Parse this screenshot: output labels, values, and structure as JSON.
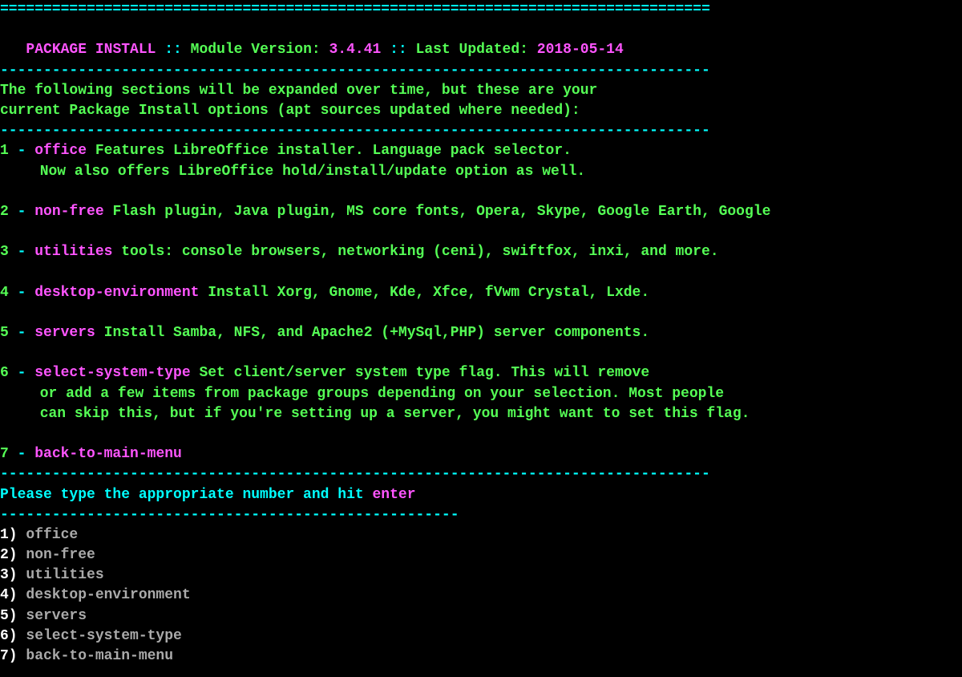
{
  "divider_eq": "==================================================================================",
  "divider_dash": "----------------------------------------------------------------------------------",
  "divider_dash_short": "-----------------------------------------------------",
  "header": {
    "title": "PACKAGE INSTALL",
    "sep": " :: ",
    "mod_label": "Module Version: ",
    "mod_version": "3.4.41",
    "updated_label": "Last Updated: ",
    "updated_value": "2018-05-14"
  },
  "intro": {
    "l1": "The following sections will be expanded over time, but these are your",
    "l2": "current Package Install options (apt sources updated where needed):"
  },
  "opts": [
    {
      "num": "1",
      "dash": " - ",
      "key": "office",
      "desc": " Features LibreOffice installer. Language pack selector.",
      "cont": [
        "Now also offers LibreOffice hold/install/update option as well."
      ]
    },
    {
      "num": "2",
      "dash": " - ",
      "key": "non-free",
      "desc": " Flash plugin, Java plugin, MS core fonts, Opera, Skype, Google Earth, Google",
      "cont": []
    },
    {
      "num": "3",
      "dash": " - ",
      "key": "utilities",
      "desc": " tools: console browsers, networking (ceni), swiftfox, inxi, and more.",
      "cont": []
    },
    {
      "num": "4",
      "dash": " - ",
      "key": "desktop-environment",
      "desc": " Install Xorg, Gnome, Kde, Xfce, fVwm Crystal, Lxde.",
      "cont": []
    },
    {
      "num": "5",
      "dash": " - ",
      "key": "servers",
      "desc": " Install Samba, NFS, and Apache2 (+MySql,PHP) server components.",
      "cont": []
    },
    {
      "num": "6",
      "dash": " - ",
      "key": "select-system-type",
      "desc": " Set client/server system type flag. This will remove",
      "cont": [
        "or add a few items from package groups depending on your selection. Most people",
        "can skip this, but if you're setting up a server, you might want to set this flag."
      ]
    },
    {
      "num": "7",
      "dash": " - ",
      "key": "back-to-main-menu",
      "desc": "",
      "cont": []
    }
  ],
  "prompt": {
    "pre": "Please type the appropriate number and hit ",
    "enter": "enter"
  },
  "list": [
    {
      "label": "1) ",
      "name": "office"
    },
    {
      "label": "2) ",
      "name": "non-free"
    },
    {
      "label": "3) ",
      "name": "utilities"
    },
    {
      "label": "4) ",
      "name": "desktop-environment"
    },
    {
      "label": "5) ",
      "name": "servers"
    },
    {
      "label": "6) ",
      "name": "select-system-type"
    },
    {
      "label": "7) ",
      "name": "back-to-main-menu"
    }
  ]
}
